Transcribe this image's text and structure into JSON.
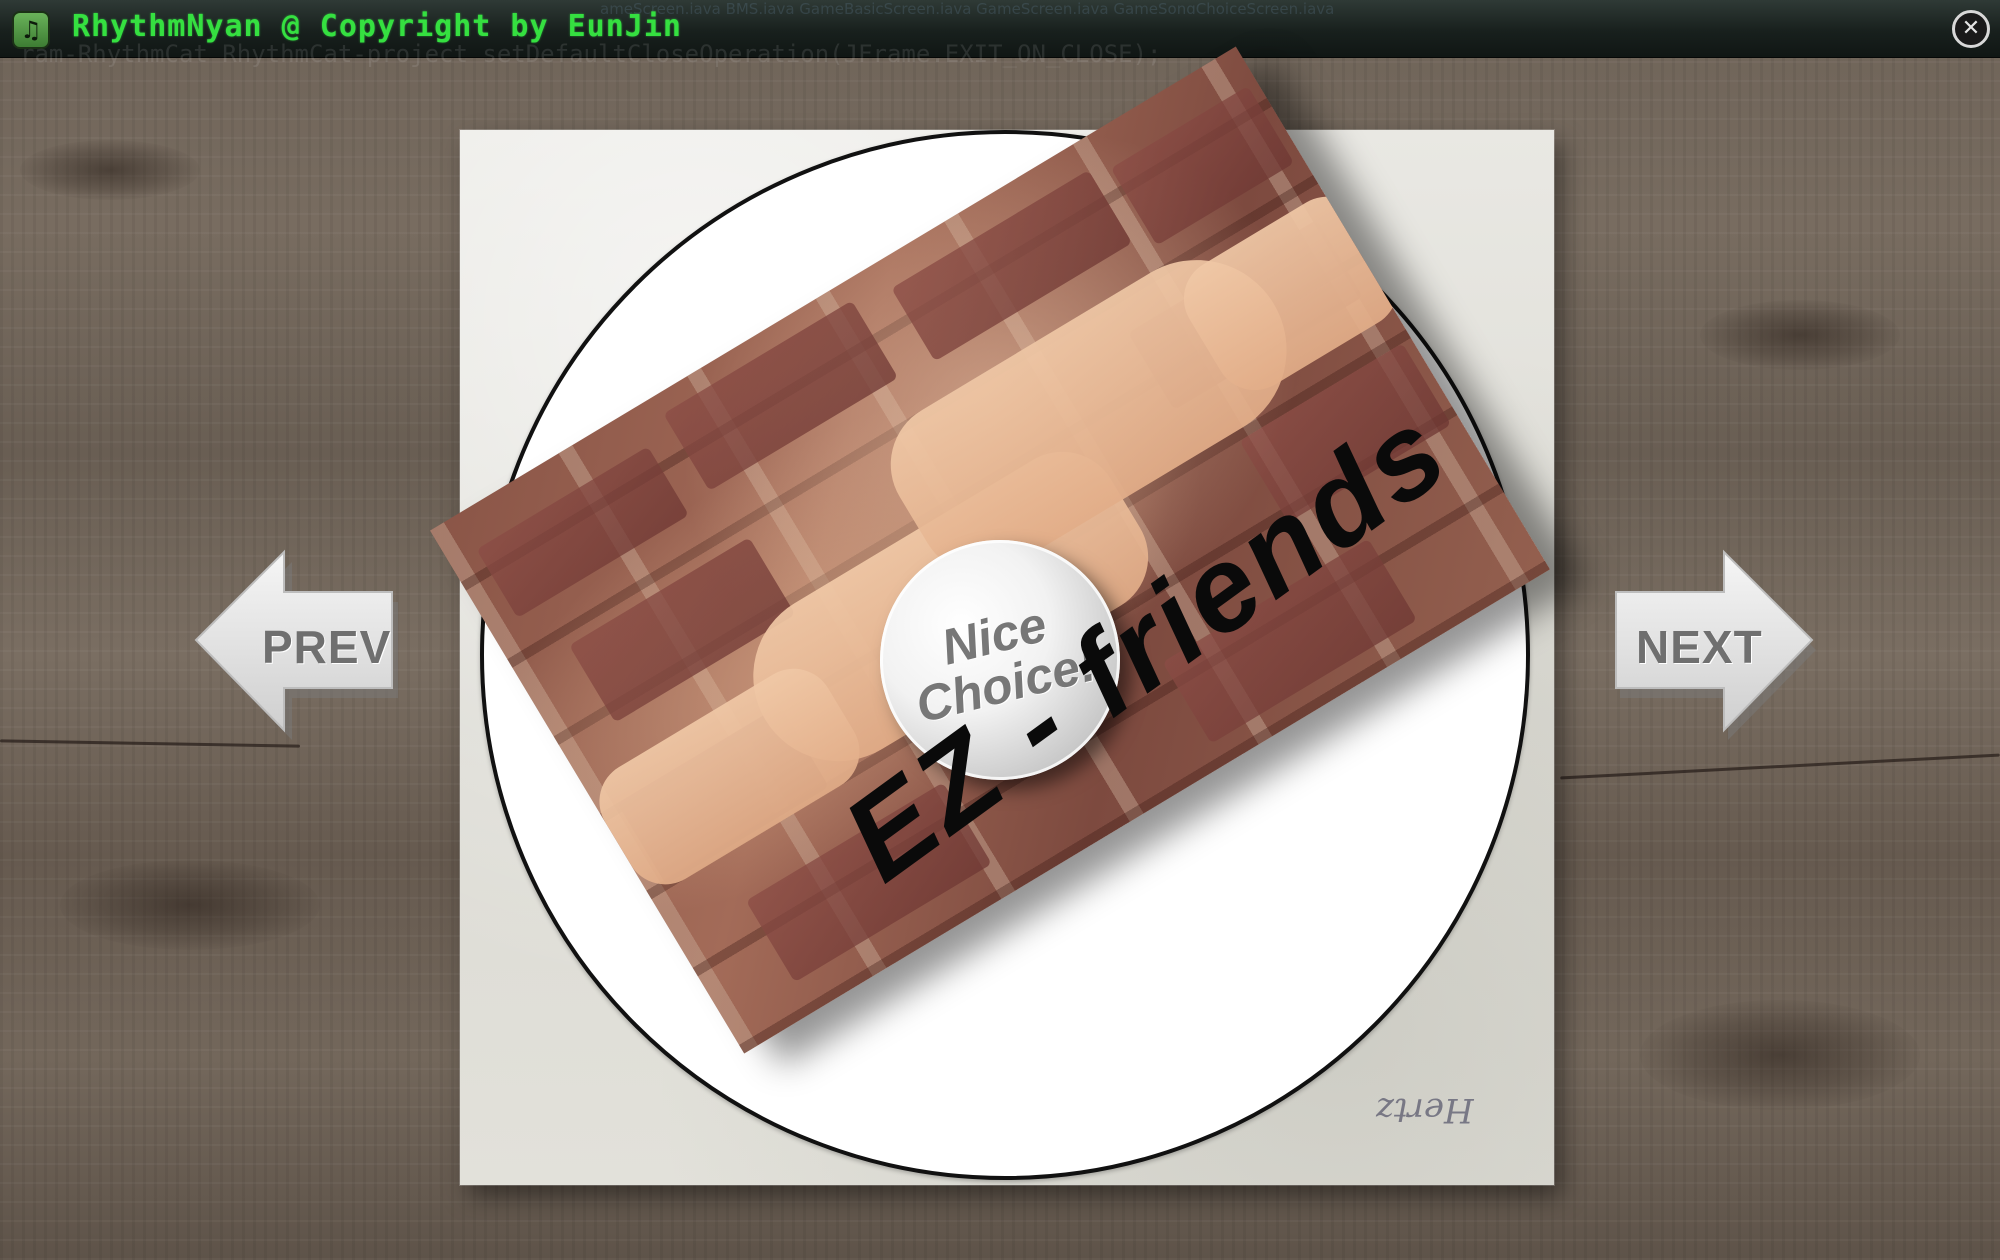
{
  "window": {
    "title": "RhythmNyan @ Copyright by EunJin",
    "icon": "music-note-icon",
    "close_icon": "close-circle-icon",
    "close_glyph": "✕",
    "ghost_tabs": "ameScreen.java   BMS.java   GameBasicScreen.java   GameScreen.java   GameSongChoiceScreen.java",
    "ghost_code": "ram-RhythmCat  RhythmCat-project          setDefaultCloseOperation(JFrame.EXIT_ON_CLOSE);"
  },
  "song": {
    "title": "EZ - friends",
    "badge_line1": "Nice",
    "badge_line2": "Choice!",
    "signature": "Hertz"
  },
  "nav": {
    "prev_label": "PREV",
    "next_label": "NEXT"
  },
  "colors": {
    "title_text": "#35e040",
    "titlebar": "#18201d",
    "wood": "#6e6358",
    "sleeve": "#e4e3dd",
    "disc": "#ffffff",
    "arrow": "#e8e8e8"
  }
}
